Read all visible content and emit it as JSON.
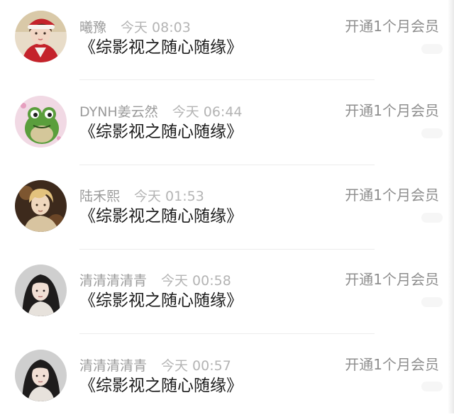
{
  "items": [
    {
      "name": "曦豫",
      "time": "今天 08:03",
      "content": "《综影视之随心随缘》",
      "action": "开通1个月会员",
      "avatar": "girl-christmas-hat-avatar"
    },
    {
      "name": "DYNH姜云然",
      "time": "今天 06:44",
      "content": "《综影视之随心随缘》",
      "action": "开通1个月会员",
      "avatar": "frog-cartoon-avatar"
    },
    {
      "name": "陆禾熙",
      "time": "今天 01:53",
      "content": "《综影视之随心随缘》",
      "action": "开通1个月会员",
      "avatar": "anime-boy-avatar"
    },
    {
      "name": "清清清清青",
      "time": "今天 00:58",
      "content": "《综影视之随心随缘》",
      "action": "开通1个月会员",
      "avatar": "girl-portrait-avatar"
    },
    {
      "name": "清清清清青",
      "time": "今天 00:57",
      "content": "《综影视之随心随缘》",
      "action": "开通1个月会员",
      "avatar": "girl-portrait-avatar"
    }
  ],
  "colors": {
    "name_text": "#9b9b9b",
    "time_text": "#b4b4b4",
    "content_text": "#1c1c1c",
    "action_text": "#8e8e8e"
  }
}
